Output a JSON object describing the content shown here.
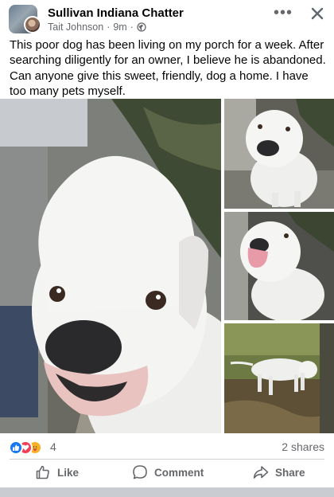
{
  "header": {
    "group_name": "Sullivan Indiana Chatter",
    "author": "Tait Johnson",
    "separator": "·",
    "time": "9m",
    "time_separator": "·",
    "privacy_icon": "globe-icon",
    "more_icon": "more-horizontal-icon",
    "close_icon": "close-icon"
  },
  "post": {
    "text": "This poor dog has been living on my porch for a week. After searching diligently for an owner, I believe he is abandoned. Can anyone give this sweet, friendly, dog a home. I have too many pets myself."
  },
  "photos": [
    {
      "name": "dog-closeup-photo"
    },
    {
      "name": "dog-sitting-photo"
    },
    {
      "name": "dog-tongue-photo"
    },
    {
      "name": "dog-in-yard-photo"
    }
  ],
  "reactions": {
    "icons": [
      "like-reaction-icon",
      "love-reaction-icon",
      "care-reaction-icon"
    ],
    "count": "4",
    "shares": "2 shares"
  },
  "actions": {
    "like_label": "Like",
    "comment_label": "Comment",
    "share_label": "Share"
  },
  "colors": {
    "text_primary": "#050505",
    "text_secondary": "#65676b",
    "like_blue": "#1877f2",
    "love_red": "#f33e58",
    "care_yellow": "#f7b125",
    "divider": "#ced0d4"
  }
}
